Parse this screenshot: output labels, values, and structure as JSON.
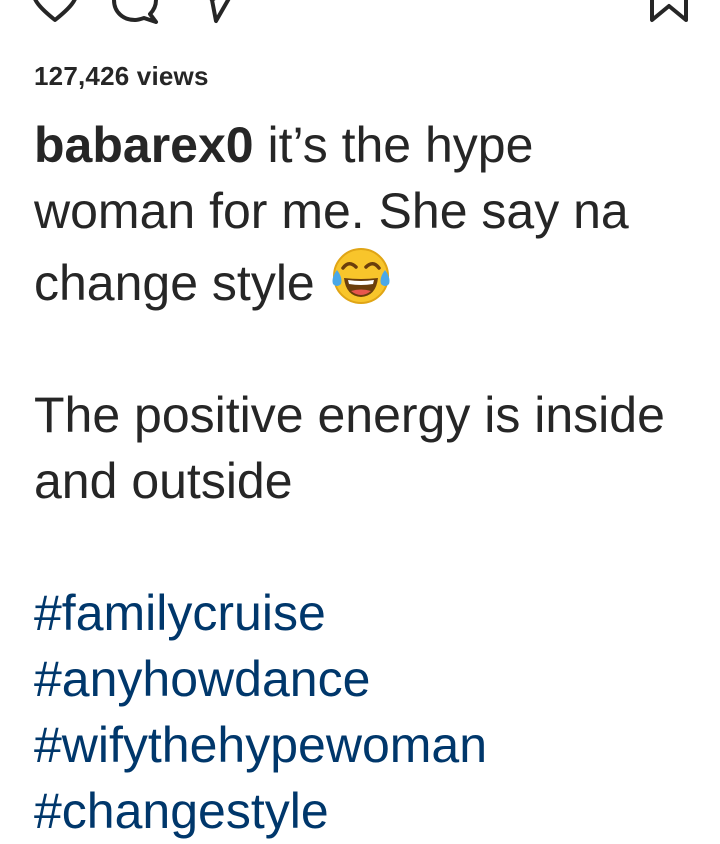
{
  "actions": {
    "like_icon": "heart-icon",
    "comment_icon": "comment-icon",
    "share_icon": "share-icon",
    "save_icon": "bookmark-icon"
  },
  "post": {
    "views": "127,426 views",
    "username": "babarex0",
    "caption_line1": " it’s the hype woman for me. She say na change style",
    "emoji": "face-with-tears-of-joy",
    "caption_line2": "The positive energy is inside and outside",
    "hashtags": [
      "#familycruise",
      "#anyhowdance",
      "#wifythehypewoman",
      "#changestyle"
    ]
  },
  "colors": {
    "text": "#262626",
    "hashtag": "#00376b",
    "background": "#ffffff"
  }
}
